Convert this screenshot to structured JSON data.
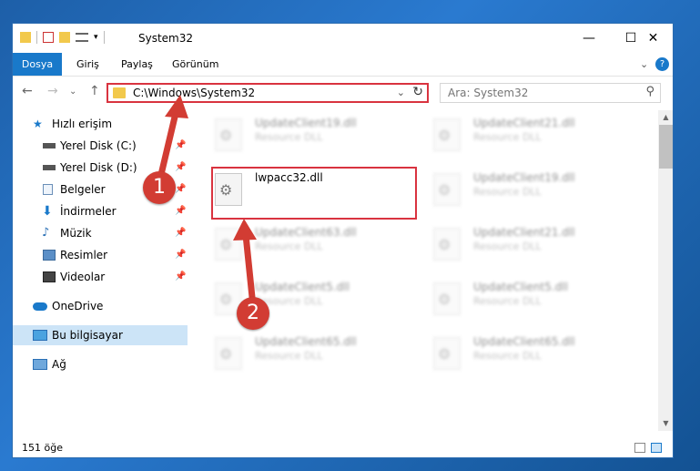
{
  "window": {
    "title": "System32",
    "minimize_glyph": "—",
    "maximize_glyph": "☐",
    "close_glyph": "✕"
  },
  "ribbon": {
    "tabs": [
      "Dosya",
      "Giriş",
      "Paylaş",
      "Görünüm"
    ],
    "file_tab_color": "#1979ca",
    "collapse_glyph": "⌄",
    "help_glyph": "?"
  },
  "navigation": {
    "back_glyph": "←",
    "forward_glyph": "→",
    "recent_glyph": "⌄",
    "up_glyph": "↑",
    "address": "C:\\Windows\\System32",
    "search_placeholder": "Ara: System32"
  },
  "nav_pane": {
    "items": [
      {
        "label": "Hızlı erişim",
        "icon": "star-icon",
        "pinned": false
      },
      {
        "label": "Yerel Disk (C:)",
        "icon": "drive-icon",
        "pinned": true
      },
      {
        "label": "Yerel Disk (D:)",
        "icon": "drive-icon",
        "pinned": true
      },
      {
        "label": "Belgeler",
        "icon": "documents-icon",
        "pinned": true
      },
      {
        "label": "İndirmeler",
        "icon": "download-icon",
        "pinned": true
      },
      {
        "label": "Müzik",
        "icon": "music-icon",
        "pinned": true
      },
      {
        "label": "Resimler",
        "icon": "pictures-icon",
        "pinned": true
      },
      {
        "label": "Videolar",
        "icon": "videos-icon",
        "pinned": true
      },
      {
        "label": "OneDrive",
        "icon": "cloud-icon",
        "pinned": false
      },
      {
        "label": "Bu bilgisayar",
        "icon": "computer-icon",
        "pinned": false,
        "selected": true
      },
      {
        "label": "Ağ",
        "icon": "network-icon",
        "pinned": false
      }
    ],
    "pin_glyph": "📌"
  },
  "files": [
    {
      "name": "UpdateClient19.dll",
      "type": "Resource DLL",
      "blurred": true
    },
    {
      "name": "UpdateClient21.dll",
      "type": "Resource DLL",
      "blurred": true
    },
    {
      "name": "lwpacc32.dll",
      "type": "",
      "blurred": false,
      "highlighted": true
    },
    {
      "name": "UpdateClient19.dll",
      "type": "Resource DLL",
      "blurred": true
    },
    {
      "name": "UpdateClient63.dll",
      "type": "Resource DLL",
      "blurred": true
    },
    {
      "name": "UpdateClient21.dll",
      "type": "Resource DLL",
      "blurred": true
    },
    {
      "name": "UpdateClient5.dll",
      "type": "Resource DLL",
      "blurred": true
    },
    {
      "name": "UpdateClient5.dll",
      "type": "Resource DLL",
      "blurred": true
    },
    {
      "name": "UpdateClient65.dll",
      "type": "Resource DLL",
      "blurred": true
    },
    {
      "name": "UpdateClient65.dll",
      "type": "Resource DLL",
      "blurred": true
    }
  ],
  "status": {
    "item_count": "151 öğe"
  },
  "annotations": {
    "marker_1": "1",
    "marker_2": "2",
    "color": "#d23c33"
  }
}
